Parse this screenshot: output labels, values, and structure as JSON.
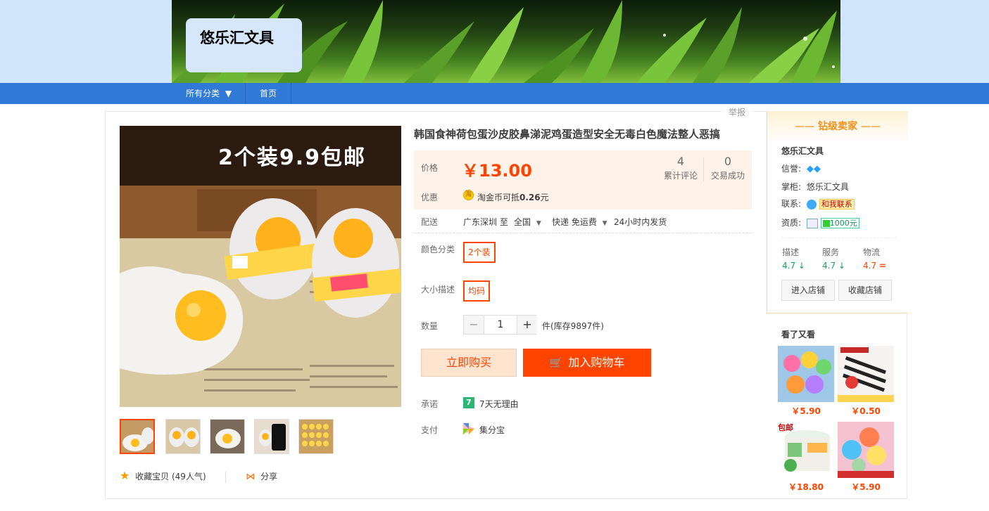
{
  "shop": {
    "name": "悠乐汇文具"
  },
  "nav": {
    "all_categories": "所有分类",
    "home": "首页"
  },
  "report": "举报",
  "product": {
    "title": "韩国食神荷包蛋沙皮胶鼻涕泥鸡蛋造型安全无毒白色魔法整人恶搞",
    "image_caption": "2个装9.9包邮",
    "price_label": "价格",
    "price": "￥13.00",
    "reviews": {
      "count": "4",
      "label": "累计评论"
    },
    "deals": {
      "count": "0",
      "label": "交易成功"
    },
    "promo_label": "优惠",
    "promo_text": "淘金币可抵",
    "promo_value": "0.26",
    "promo_unit": "元",
    "shipping_label": "配送",
    "ship_from": "广东深圳 至",
    "ship_to": "全国",
    "ship_method": "快递 免运费",
    "ship_time": "24小时内发货",
    "color_label": "颜色分类",
    "color_option": "2个装",
    "size_label": "大小描述",
    "size_option": "均码",
    "qty_label": "数量",
    "qty_value": "1",
    "stock": "件(库存9897件)",
    "buy_now": "立即购买",
    "add_cart": "加入购物车",
    "promise_label": "承诺",
    "promise_text": "7天无理由",
    "pay_label": "支付",
    "pay_text": "集分宝",
    "fav_text": "收藏宝贝 (49人气)",
    "share_text": "分享"
  },
  "seller": {
    "heading": "钻级卖家",
    "name": "悠乐汇文具",
    "credit_label": "信誉:",
    "keeper_label": "掌柜:",
    "keeper_name": "悠乐汇文具",
    "contact_label": "联系:",
    "contact_text": "和我联系",
    "qual_label": "资质:",
    "deposit": "1000元",
    "ratings": [
      {
        "label": "描述",
        "value": "4.7",
        "mark": "↓",
        "color": "#1aa060"
      },
      {
        "label": "服务",
        "value": "4.7",
        "mark": "↓",
        "color": "#1aa060"
      },
      {
        "label": "物流",
        "value": "4.7",
        "mark": "=",
        "color": "#f40"
      }
    ],
    "enter_shop": "进入店铺",
    "fav_shop": "收藏店铺"
  },
  "also_viewed": {
    "heading": "看了又看",
    "items": [
      {
        "price": "￥5.90"
      },
      {
        "price": "￥0.50"
      },
      {
        "price": "￥18.80",
        "tag": "包邮"
      },
      {
        "price": "￥5.90"
      }
    ]
  }
}
